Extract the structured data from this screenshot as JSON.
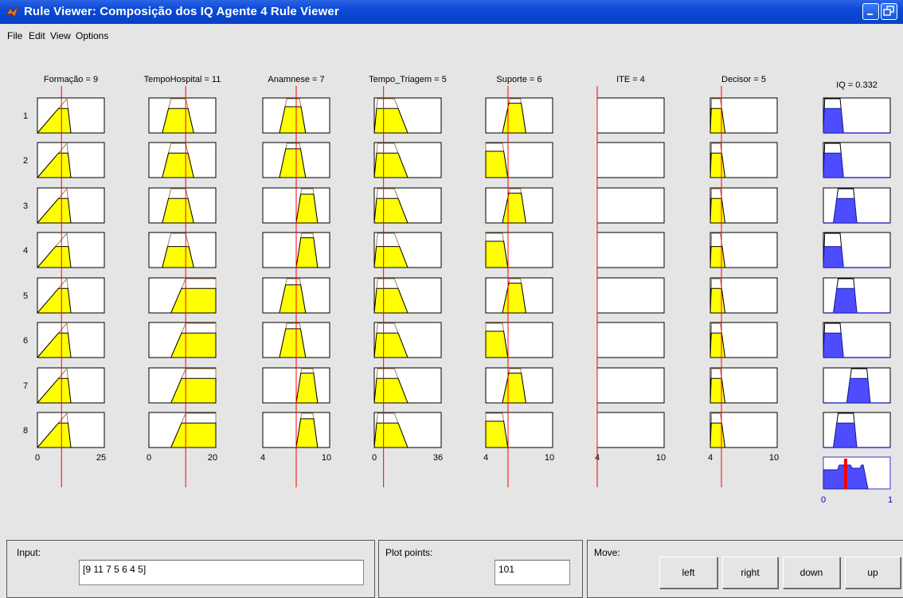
{
  "window": {
    "title": "Rule Viewer: Composição dos IQ Agente 4 Rule Viewer"
  },
  "menu": {
    "items": [
      "File",
      "Edit",
      "View",
      "Options"
    ]
  },
  "inputs": [
    {
      "label": "Formação = 9",
      "min": "0",
      "max": "25",
      "lo": 0,
      "hi": 25,
      "value": 9
    },
    {
      "label": "TempoHospital = 11",
      "min": "0",
      "max": "20",
      "lo": 0,
      "hi": 20,
      "value": 11
    },
    {
      "label": "Anamnese = 7",
      "min": "4",
      "max": "10",
      "lo": 4,
      "hi": 10,
      "value": 7
    },
    {
      "label": "Tempo_Triagem = 5",
      "min": "0",
      "max": "36",
      "lo": 0,
      "hi": 36,
      "value": 5
    },
    {
      "label": "Suporte = 6",
      "min": "4",
      "max": "10",
      "lo": 4,
      "hi": 10,
      "value": 6
    },
    {
      "label": "ITE = 4",
      "min": "4",
      "max": "10",
      "lo": 4,
      "hi": 10,
      "value": 4
    },
    {
      "label": "Decisor = 5",
      "min": "4",
      "max": "10",
      "lo": 4,
      "hi": 10,
      "value": 5
    }
  ],
  "output": {
    "label": "IQ = 0.332",
    "min": "0",
    "max": "1",
    "value": 0.332
  },
  "rules": [
    "1",
    "2",
    "3",
    "4",
    "5",
    "6",
    "7",
    "8"
  ],
  "bottom": {
    "input_label": "Input:",
    "input_value": "[9 11 7 5 6 4 5]",
    "plot_points_label": "Plot points:",
    "plot_points_value": "101",
    "move_label": "Move:",
    "buttons": [
      "left",
      "right",
      "down",
      "up"
    ]
  },
  "colors": {
    "antecedent_fill": "#ffff00",
    "consequent_fill": "#4d4dff",
    "marker": "#ff0000",
    "title_bar": "#0a49d8"
  }
}
